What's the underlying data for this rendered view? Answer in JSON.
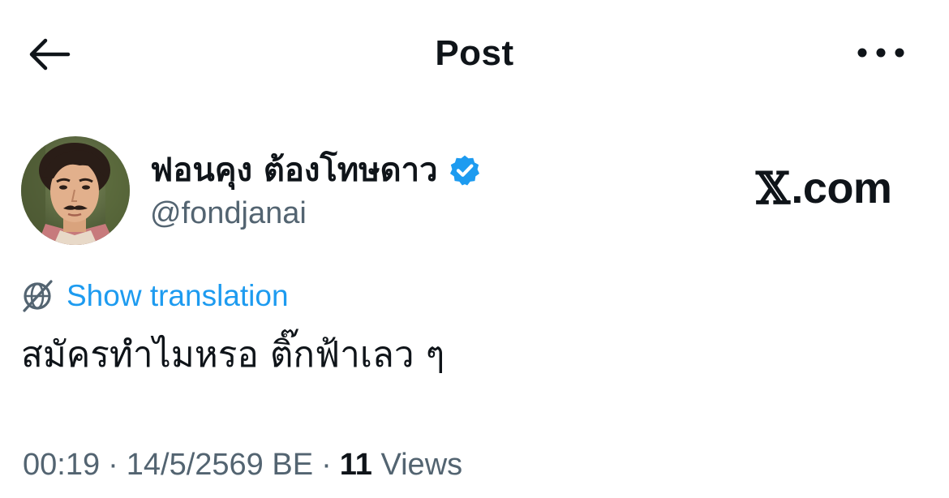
{
  "header": {
    "title": "Post",
    "back_icon": "arrow-left-icon",
    "more_icon": "more-horizontal-icon"
  },
  "author": {
    "display_name": "ฟอนคุง ต้องโทษดาว",
    "handle": "@fondjanai",
    "verified": true,
    "verified_color": "#1d9bf0"
  },
  "watermark": {
    "x_mark": "𝕏",
    "domain": ".com"
  },
  "translation": {
    "label": "Show translation",
    "icon": "globe-translate-icon",
    "color": "#1d9bf0"
  },
  "post": {
    "text": "สมัครทำไมหรอ ติ๊กฟ้าเลว ๆ"
  },
  "meta": {
    "time": "00:19",
    "separator": "·",
    "date": "14/5/2569 BE",
    "views_count": "11",
    "views_label": "Views"
  },
  "colors": {
    "text_primary": "#0f1419",
    "text_secondary": "#536471",
    "accent": "#1d9bf0"
  }
}
